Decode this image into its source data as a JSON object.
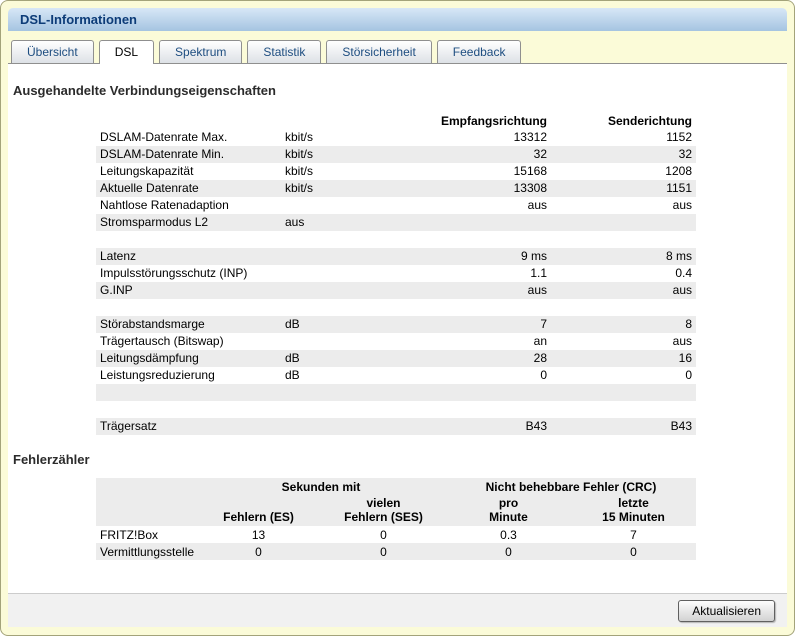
{
  "window": {
    "title": "DSL-Informationen"
  },
  "theme": {
    "page_background": "#fbfbd8",
    "titlebar_gradient_top": "#d7e7f6",
    "titlebar_gradient_bottom": "#a5c4e1",
    "titlebar_text": "#0d3c78",
    "row_stripe": "#ececec"
  },
  "tabs": [
    {
      "id": "uebersicht",
      "label": "Übersicht",
      "active": false
    },
    {
      "id": "dsl",
      "label": "DSL",
      "active": true
    },
    {
      "id": "spektrum",
      "label": "Spektrum",
      "active": false
    },
    {
      "id": "statistik",
      "label": "Statistik",
      "active": false
    },
    {
      "id": "stoersicherheit",
      "label": "Störsicherheit",
      "active": false
    },
    {
      "id": "feedback",
      "label": "Feedback",
      "active": false
    }
  ],
  "connection_section": {
    "heading": "Ausgehandelte Verbindungseigenschaften",
    "table": {
      "header_rx": "Empfangsrichtung",
      "header_tx": "Senderichtung",
      "rows": [
        {
          "name": "DSLAM-Datenrate Max.",
          "unit": "kbit/s",
          "rx": "13312",
          "tx": "1152"
        },
        {
          "name": "DSLAM-Datenrate Min.",
          "unit": "kbit/s",
          "rx": "32",
          "tx": "32"
        },
        {
          "name": "Leitungskapazität",
          "unit": "kbit/s",
          "rx": "15168",
          "tx": "1208"
        },
        {
          "name": "Aktuelle Datenrate",
          "unit": "kbit/s",
          "rx": "13308",
          "tx": "1151"
        },
        {
          "name": "Nahtlose Ratenadaption",
          "unit": "",
          "rx": "aus",
          "tx": "aus"
        },
        {
          "name": "Stromsparmodus L2",
          "unit": "aus",
          "rx": "",
          "tx": ""
        },
        {
          "name": "",
          "unit": "",
          "rx": "",
          "tx": ""
        },
        {
          "name": "Latenz",
          "unit": "",
          "rx": "9 ms",
          "tx": "8 ms"
        },
        {
          "name": "Impulsstörungsschutz (INP)",
          "unit": "",
          "rx": "1.1",
          "tx": "0.4"
        },
        {
          "name": "G.INP",
          "unit": "",
          "rx": "aus",
          "tx": "aus"
        },
        {
          "name": "",
          "unit": "",
          "rx": "",
          "tx": ""
        },
        {
          "name": "Störabstandsmarge",
          "unit": "dB",
          "rx": "7",
          "tx": "8"
        },
        {
          "name": "Trägertausch (Bitswap)",
          "unit": "",
          "rx": "an",
          "tx": "aus"
        },
        {
          "name": "Leitungsdämpfung",
          "unit": "dB",
          "rx": "28",
          "tx": "16"
        },
        {
          "name": "Leistungsreduzierung",
          "unit": "dB",
          "rx": "0",
          "tx": "0"
        },
        {
          "name": "",
          "unit": "",
          "rx": "",
          "tx": ""
        },
        {
          "name": "",
          "unit": "",
          "rx": "",
          "tx": ""
        },
        {
          "name": "Trägersatz",
          "unit": "",
          "rx": "B43",
          "tx": "B43"
        }
      ]
    }
  },
  "error_section": {
    "heading": "Fehlerzähler",
    "table": {
      "group_headers": [
        "Sekunden mit",
        "Nicht behebbare Fehler (CRC)"
      ],
      "col_headers": [
        "Fehlern (ES)",
        "vielen\nFehlern (SES)",
        "pro\nMinute",
        "letzte\n15 Minuten"
      ],
      "rows": [
        {
          "name": "FRITZ!Box",
          "values": [
            "13",
            "0",
            "0.3",
            "7"
          ]
        },
        {
          "name": "Vermittlungsstelle",
          "values": [
            "0",
            "0",
            "0",
            "0"
          ]
        }
      ]
    }
  },
  "footer": {
    "refresh_label": "Aktualisieren"
  }
}
